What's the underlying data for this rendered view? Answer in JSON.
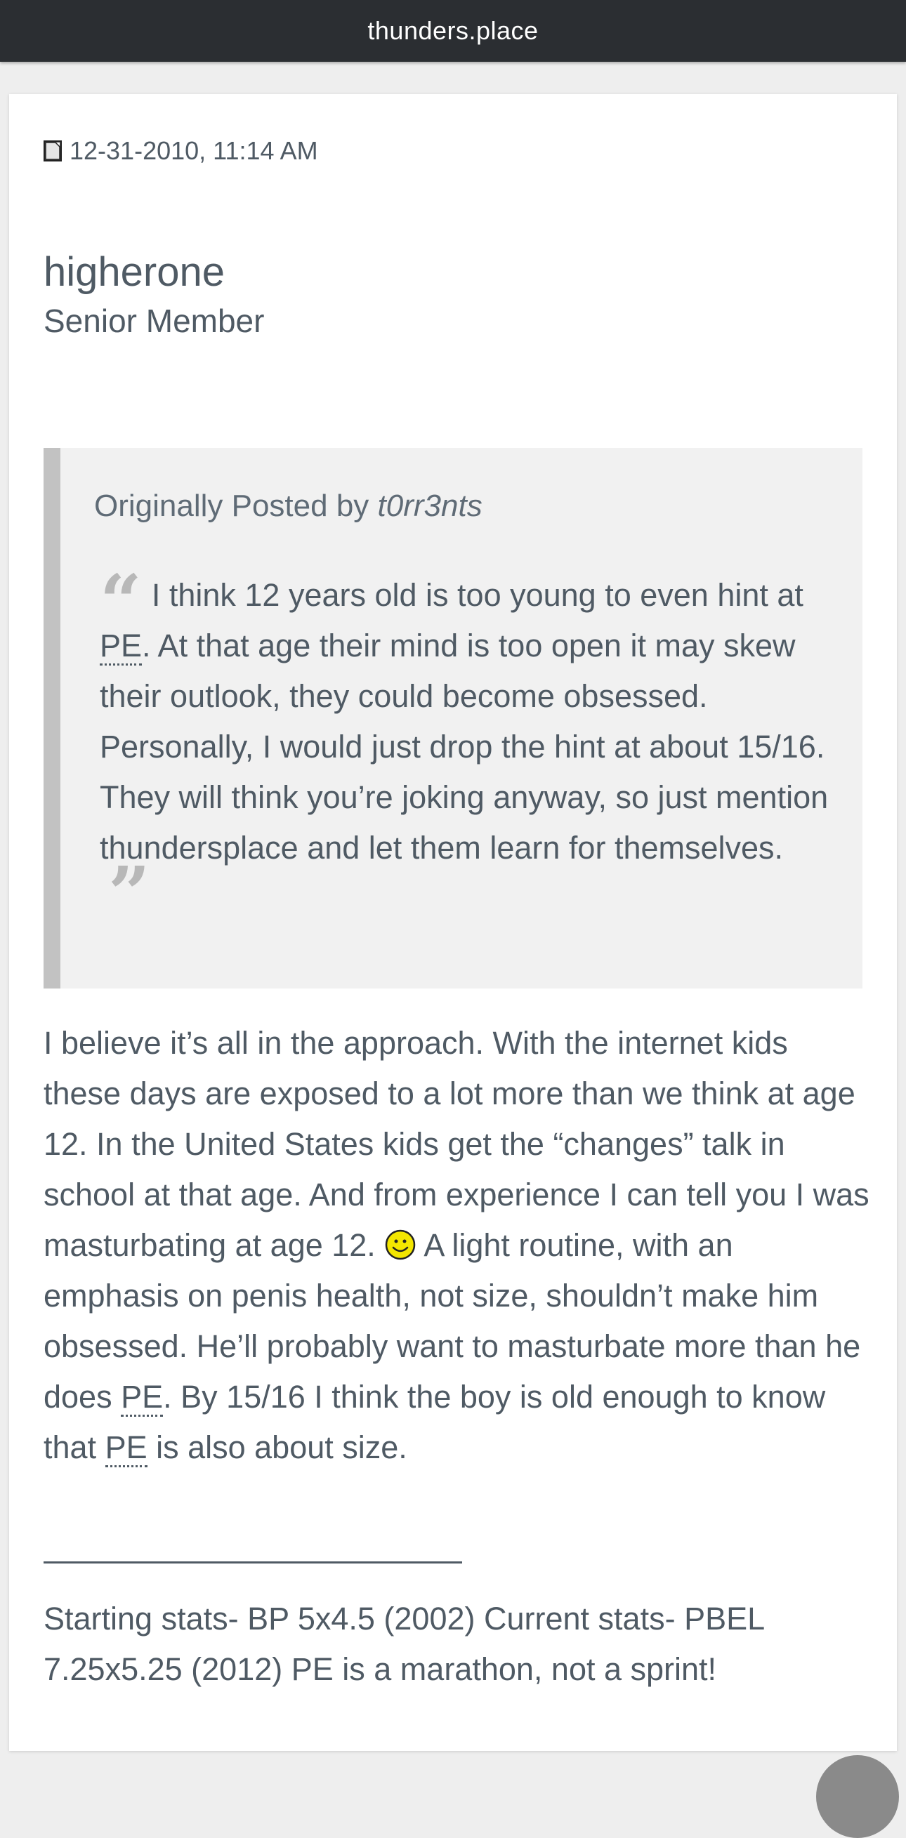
{
  "topbar": {
    "site": "thunders.place"
  },
  "post": {
    "date": "12-31-2010, 11:14 AM",
    "username": "higherone",
    "usertitle": "Senior Member",
    "quote": {
      "prefix": "Originally Posted by",
      "author": "t0rr3nts",
      "text_1": "I think 12 years old is too young to even hint at ",
      "abbr_1": "PE",
      "text_2": ". At that age their mind is too open it may skew their outlook, they could become obsessed. Personally, I would just drop the hint at about 15/16. They will think you’re joking anyway, so just mention thundersplace and let them learn for themselves."
    },
    "body": {
      "part_1": "I believe it’s all in the approach. With the internet kids these days are exposed to a lot more than we think at age 12. In the United States kids get the “changes” talk in school at that age. And from experience I can tell you I was masturbating at age 12.",
      "part_2": " A light routine, with an emphasis on penis health, not size, shouldn’t make him obsessed. He’ll probably want to masturbate more than he does ",
      "abbr_1": "PE",
      "part_3": ". By 15/16 I think the boy is old enough to know that ",
      "abbr_2": "PE",
      "part_4": " is also about size."
    },
    "signature": "Starting stats- BP 5x4.5 (2002) Current stats- PBEL 7.25x5.25 (2012) PE is a marathon, not a sprint!"
  },
  "icons": {
    "post": "post-document-icon",
    "smiley": "smiley-icon",
    "fab": "floating-action-button"
  },
  "colors": {
    "topbar": "#2b2e32",
    "text": "#4f5a64",
    "quote_bg": "#f1f1f1",
    "quote_border": "#c2c2c2",
    "page_bg": "#eeeeee"
  }
}
